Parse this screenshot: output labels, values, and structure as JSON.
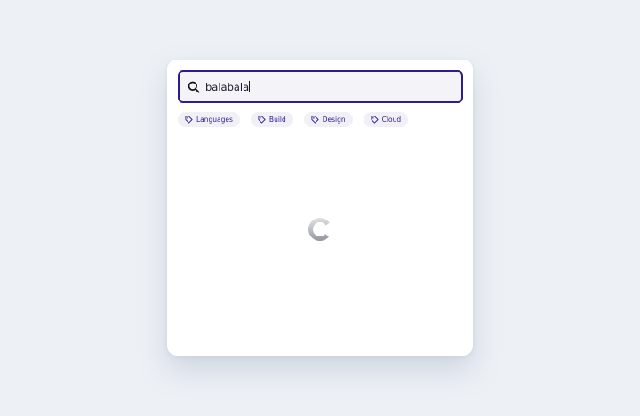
{
  "search": {
    "value": "balabala",
    "icon": "search-icon"
  },
  "chips": [
    {
      "label": "Languages",
      "icon": "tag-icon"
    },
    {
      "label": "Build",
      "icon": "tag-icon"
    },
    {
      "label": "Design",
      "icon": "tag-icon"
    },
    {
      "label": "Cloud",
      "icon": "tag-icon"
    }
  ],
  "status": {
    "loading": true,
    "icon": "loading-spinner-icon"
  },
  "colors": {
    "accent": "#2f1a8f",
    "background": "#edf1f6",
    "input_bg": "#f3f3f8",
    "chip_bg": "#f1f0f6"
  }
}
